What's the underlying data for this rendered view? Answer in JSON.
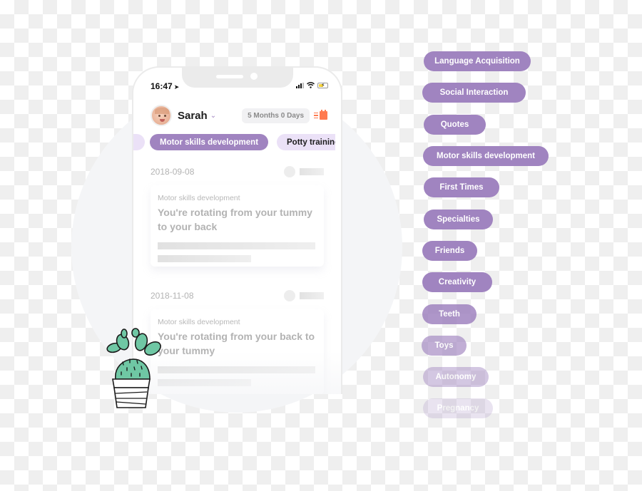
{
  "phone": {
    "status_bar": {
      "time": "16:47",
      "location_icon": "location-arrow-icon",
      "icons": [
        "signal-icon",
        "wifi-icon",
        "battery-charging-icon"
      ]
    },
    "profile": {
      "name": "Sarah",
      "age": "5 Months 0 Days",
      "dropdown_icon": "chevron-down-icon",
      "calendar_icon": "calendar-icon"
    },
    "chips": [
      {
        "label": "",
        "state": "previous"
      },
      {
        "label": "Motor skills development",
        "state": "active"
      },
      {
        "label": "Potty training",
        "state": "inactive"
      }
    ],
    "entries": [
      {
        "date": "2018-09-08",
        "category": "Motor skills development",
        "title": "You're rotating from your tummy to your back"
      },
      {
        "date": "2018-11-08",
        "category": "Motor skills development",
        "title": "You're rotating from your back to your tummy"
      }
    ]
  },
  "tags": [
    {
      "label": "Language Acquisition",
      "opacity": 1
    },
    {
      "label": "Social Interaction",
      "opacity": 1
    },
    {
      "label": "Quotes",
      "opacity": 1
    },
    {
      "label": "Motor skills development",
      "opacity": 1
    },
    {
      "label": "First Times",
      "opacity": 1
    },
    {
      "label": "Specialties",
      "opacity": 1
    },
    {
      "label": "Friends",
      "opacity": 1
    },
    {
      "label": "Creativity",
      "opacity": 1
    },
    {
      "label": "Teeth",
      "opacity": 0.85
    },
    {
      "label": "Toys",
      "opacity": 0.65
    },
    {
      "label": "Autonomy",
      "opacity": 0.45
    },
    {
      "label": "Pregnancy",
      "opacity": 0.22
    }
  ],
  "colors": {
    "accent": "#a084c0",
    "chip_inactive": "#ebe1f7",
    "calendar": "#ff7a4f",
    "cactus": "#6fc7a4"
  }
}
